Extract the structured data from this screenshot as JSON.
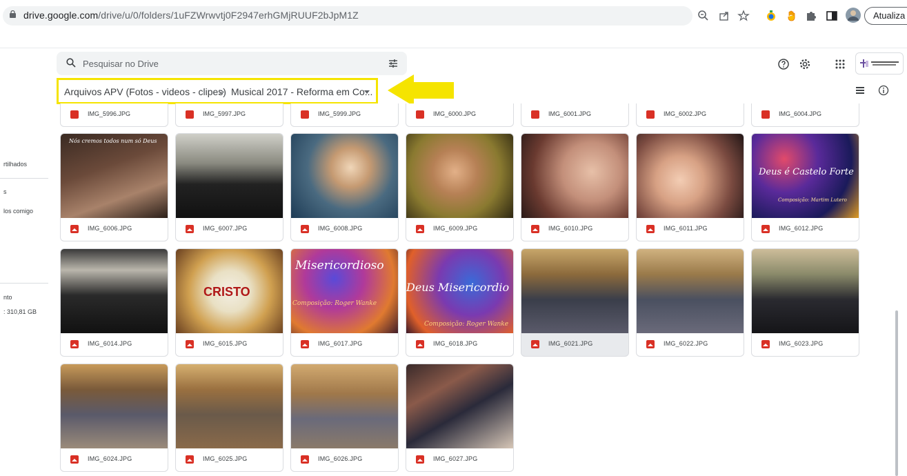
{
  "browser": {
    "url_host": "drive.google.com",
    "url_path": "/drive/u/0/folders/1uFZWrwvtj0F2947erhGMjRUUF2bJpM1Z",
    "update_label": "Atualiza"
  },
  "drive": {
    "search_placeholder": "Pesquisar no Drive",
    "breadcrumb_parent": "Arquivos APV (Fotos - videos - clipes)",
    "breadcrumb_sep": ">",
    "breadcrumb_current": "Musical 2017 - Reforma em Co..."
  },
  "sidebar": {
    "item1": "rtilhados",
    "item2": "s",
    "item3": "los comigo",
    "item4": "nto",
    "storage": ": 310,81 GB"
  },
  "top_row": [
    "IMG_5996.JPG",
    "IMG_5997.JPG",
    "IMG_5999.JPG",
    "IMG_6000.JPG",
    "IMG_6001.JPG",
    "IMG_6002.JPG",
    "IMG_6004.JPG"
  ],
  "files": [
    {
      "name": "IMG_6006.JPG"
    },
    {
      "name": "IMG_6007.JPG"
    },
    {
      "name": "IMG_6008.JPG"
    },
    {
      "name": "IMG_6009.JPG"
    },
    {
      "name": "IMG_6010.JPG"
    },
    {
      "name": "IMG_6011.JPG"
    },
    {
      "name": "IMG_6012.JPG"
    },
    {
      "name": "IMG_6014.JPG"
    },
    {
      "name": "IMG_6015.JPG"
    },
    {
      "name": "IMG_6017.JPG"
    },
    {
      "name": "IMG_6018.JPG"
    },
    {
      "name": "IMG_6021.JPG"
    },
    {
      "name": "IMG_6022.JPG"
    },
    {
      "name": "IMG_6023.JPG"
    },
    {
      "name": "IMG_6024.JPG"
    },
    {
      "name": "IMG_6025.JPG"
    },
    {
      "name": "IMG_6026.JPG"
    },
    {
      "name": "IMG_6027.JPG"
    }
  ],
  "thumb_text": {
    "t6006": "Nós cremos todos num só Deus",
    "t6012a": "Deus é Castelo Forte",
    "t6012b": "Composição: Martim Lutero",
    "t6015": "CRISTO",
    "t6017a": "Misericordioso",
    "t6017b": "Composição: Roger Wanke",
    "t6018a": "Deus Misericordio",
    "t6018b": "Composição: Roger Wanke"
  },
  "colors": {
    "highlight": "#f5e400",
    "file_icon": "#d93025"
  }
}
